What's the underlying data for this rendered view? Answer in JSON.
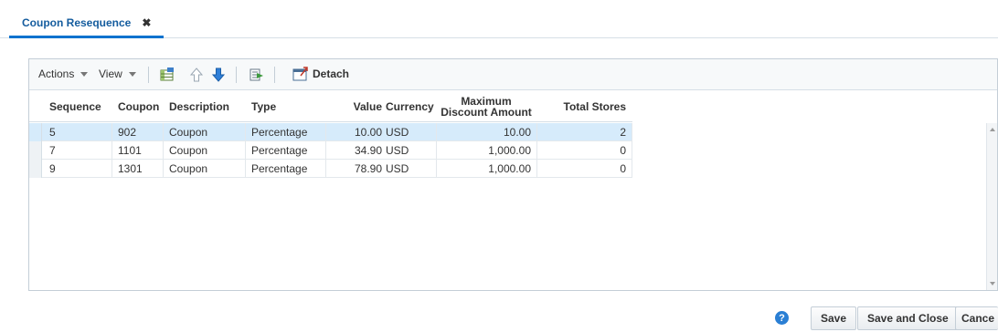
{
  "tab": {
    "title": "Coupon Resequence",
    "close_label": "✖"
  },
  "toolbar": {
    "actions_label": "Actions",
    "view_label": "View",
    "detach_label": "Detach",
    "icons": [
      "freeze-columns-icon",
      "move-up-icon",
      "move-down-icon",
      "wrap-icon",
      "detach-icon"
    ]
  },
  "table": {
    "headers": {
      "sequence": "Sequence",
      "coupon": "Coupon",
      "description": "Description",
      "type": "Type",
      "value": "Value",
      "currency": "Currency",
      "max_line1": "Maximum",
      "max_line2": "Discount Amount",
      "total_stores": "Total Stores"
    },
    "rows": [
      {
        "sequence": "5",
        "coupon": "902",
        "description": "Coupon",
        "type": "Percentage",
        "value": "10.00",
        "currency": "USD",
        "max_discount": "10.00",
        "total_stores": "2"
      },
      {
        "sequence": "7",
        "coupon": "1101",
        "description": "Coupon",
        "type": "Percentage",
        "value": "34.90",
        "currency": "USD",
        "max_discount": "1,000.00",
        "total_stores": "0"
      },
      {
        "sequence": "9",
        "coupon": "1301",
        "description": "Coupon",
        "type": "Percentage",
        "value": "78.90",
        "currency": "USD",
        "max_discount": "1,000.00",
        "total_stores": "0"
      }
    ]
  },
  "footer": {
    "help_label": "?",
    "save_label": "Save",
    "save_close_label": "Save and Close",
    "cancel_label": "Cance"
  },
  "colors": {
    "accent": "#0572ce",
    "selected_row": "#d6ebfb",
    "help": "#2a7fd4"
  }
}
